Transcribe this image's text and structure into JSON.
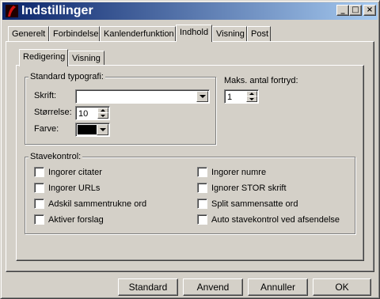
{
  "window": {
    "title": "Indstillinger",
    "controls": {
      "minimize": "_",
      "maximize": "□",
      "close": "×"
    }
  },
  "tabs": [
    {
      "label": "Generelt"
    },
    {
      "label": "Forbindelse"
    },
    {
      "label": "Kanlenderfunktion"
    },
    {
      "label": "Indhold",
      "active": true
    },
    {
      "label": "Visning"
    },
    {
      "label": "Post"
    }
  ],
  "subtabs": [
    {
      "label": "Redigering",
      "active": true
    },
    {
      "label": "Visning"
    }
  ],
  "typography": {
    "legend": "Standard typografi:",
    "font_label": "Skrift:",
    "font_value": "",
    "size_label": "Størrelse:",
    "size_value": "10",
    "color_label": "Farve:",
    "color_value": "#000000"
  },
  "undo": {
    "label": "Maks. antal fortryd:",
    "value": "1"
  },
  "spellcheck": {
    "legend": "Stavekontrol:",
    "left": [
      {
        "label": "Ingorer citater",
        "checked": false
      },
      {
        "label": "Ingorer URLs",
        "checked": false
      },
      {
        "label": "Adskil sammentrukne ord",
        "checked": false
      },
      {
        "label": "Aktiver forslag",
        "checked": false
      }
    ],
    "right": [
      {
        "label": "Ingorer numre",
        "checked": false
      },
      {
        "label": "Ignorer STOR skrift",
        "checked": false
      },
      {
        "label": "Split sammensatte ord",
        "checked": false
      },
      {
        "label": "Auto stavekontrol ved afsendelse",
        "checked": false
      }
    ]
  },
  "buttons": {
    "standard": "Standard",
    "apply": "Anvend",
    "cancel": "Annuller",
    "ok": "OK"
  },
  "colors": {
    "title_start": "#0a246a",
    "title_end": "#a6caf0",
    "face": "#d4d0c8"
  },
  "icons": {
    "app": "app-logo-icon",
    "font_dropdown": "chevron-down-icon",
    "color_dropdown": "chevron-down-icon",
    "spinner": "spin-arrows-icon"
  }
}
